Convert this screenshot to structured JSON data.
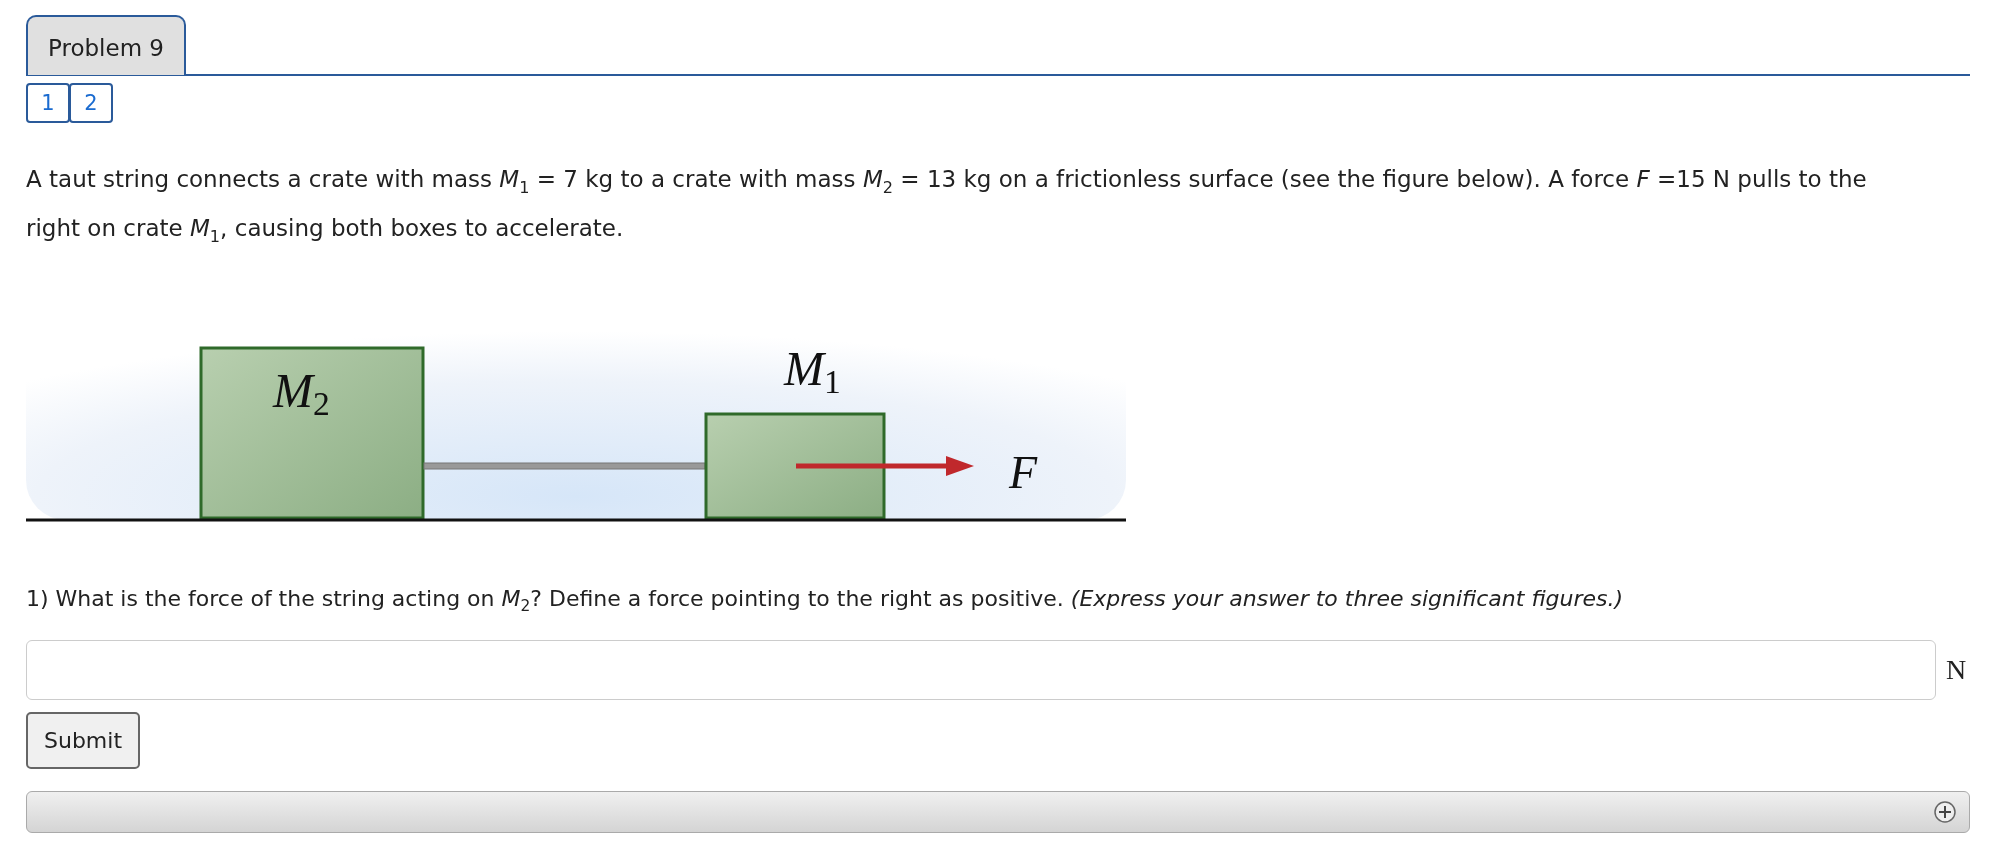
{
  "tab": {
    "label": "Problem 9"
  },
  "pages": [
    "1",
    "2"
  ],
  "problem_text": "A taut string connects a crate with mass *M*$_{1}$ = 7 kg to a crate with mass *M*$_{2}$ = 13 kg on a frictionless surface (see the figure below). A force *F* =15 N pulls to the right on crate *M*$_{1}$, causing both boxes to accelerate.",
  "figure": {
    "labels": [
      {
        "kind": "m2",
        "main": "M",
        "sub": "2"
      },
      {
        "kind": "m1",
        "main": "M",
        "sub": "1"
      },
      {
        "kind": "force",
        "main": "F"
      }
    ]
  },
  "question": "1) What is the force of the string acting on *M*$_{2}$? Define a force pointing to the right as positive. *(Express your answer to three significant figures.)*",
  "answer": {
    "unit": "N"
  },
  "submit": "Submit"
}
